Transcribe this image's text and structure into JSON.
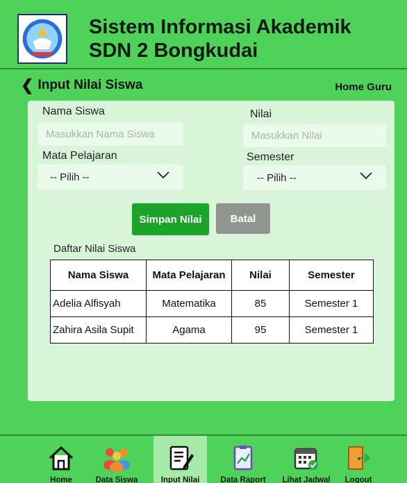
{
  "header": {
    "title_line1": "Sistem Informasi Akademik",
    "title_line2": "SDN 2 Bongkudai"
  },
  "subbar": {
    "back_label": "Input Nilai Siswa",
    "breadcrumb": "Home  Guru"
  },
  "form": {
    "student_name_label": "Nama Siswa",
    "student_name_placeholder": "Masukkan Nama Siswa",
    "grade_label": "Nilai",
    "grade_placeholder": "Masukkan Nilai",
    "subject_label": "Mata Pelajaran",
    "subject_selected": "-- Pilih --",
    "semester_label": "Semester",
    "semester_selected": "-- Pilih --",
    "save_label": "Simpan Nilai",
    "cancel_label": "Batal"
  },
  "table": {
    "title": "Daftar Nilai Siswa",
    "columns": [
      "Nama Siswa",
      "Mata Pelajaran",
      "Nilai",
      "Semester"
    ],
    "rows": [
      [
        "Adelia Alfisyah",
        "Matematika",
        "85",
        "Semester 1"
      ],
      [
        "Zahira Asila Supit",
        "Agama",
        "95",
        "Semester 1"
      ]
    ]
  },
  "nav": {
    "items": [
      {
        "label": "Home",
        "icon": "home-icon"
      },
      {
        "label": "Data Siswa",
        "icon": "students-icon"
      },
      {
        "label": "Input Nilai",
        "icon": "edit-list-icon",
        "active": true
      },
      {
        "label": "Data Raport",
        "icon": "report-chart-icon"
      },
      {
        "label": "Lihat Jadwal",
        "icon": "calendar-check-icon"
      },
      {
        "label": "Logout",
        "icon": "logout-door-icon"
      }
    ]
  },
  "colors": {
    "background": "#4fd25a",
    "card": "#d9f5d9",
    "save_button": "#1ba32a",
    "cancel_button": "#8f958f",
    "active_nav": "#a6eaa8"
  }
}
